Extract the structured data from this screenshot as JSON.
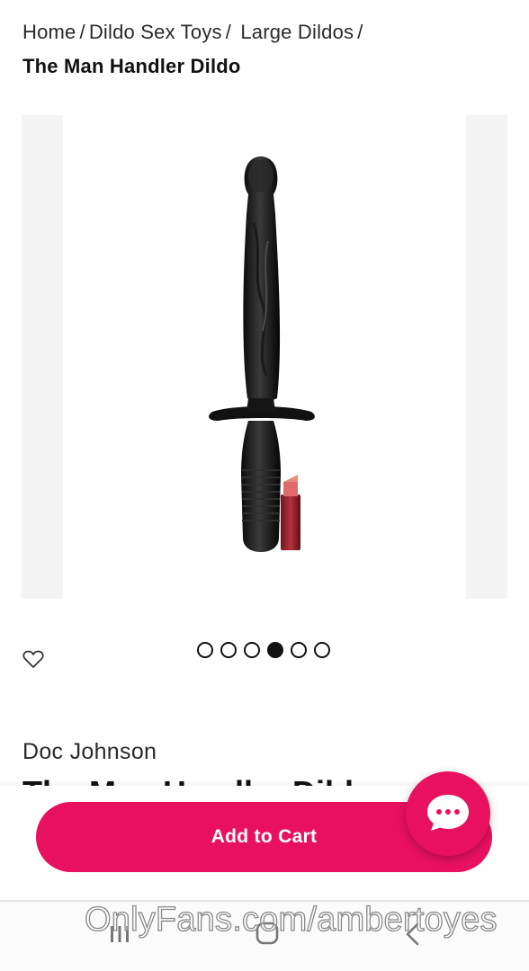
{
  "breadcrumb": {
    "items": [
      "Home",
      "Dildo Sex Toys",
      " Large Dildos"
    ],
    "separator": "/",
    "current": "The Man Handler Dildo"
  },
  "gallery": {
    "image_icon": "product-photo",
    "slide_count": 6,
    "active_slide": 4
  },
  "wishlist": {
    "icon": "heart-outline-icon"
  },
  "product": {
    "brand": "Doc Johnson",
    "title": "The Man Handler Dildo"
  },
  "actions": {
    "add_to_cart": "Add to Cart",
    "chat_icon": "chat-bubble-icon"
  },
  "colors": {
    "accent": "#e8115f",
    "text": "#1c1c1c"
  },
  "system_nav": {
    "recent_icon": "recent-apps-icon",
    "home_icon": "home-icon",
    "back_icon": "back-icon"
  },
  "watermark": "OnlyFans.com/ambertoyes"
}
